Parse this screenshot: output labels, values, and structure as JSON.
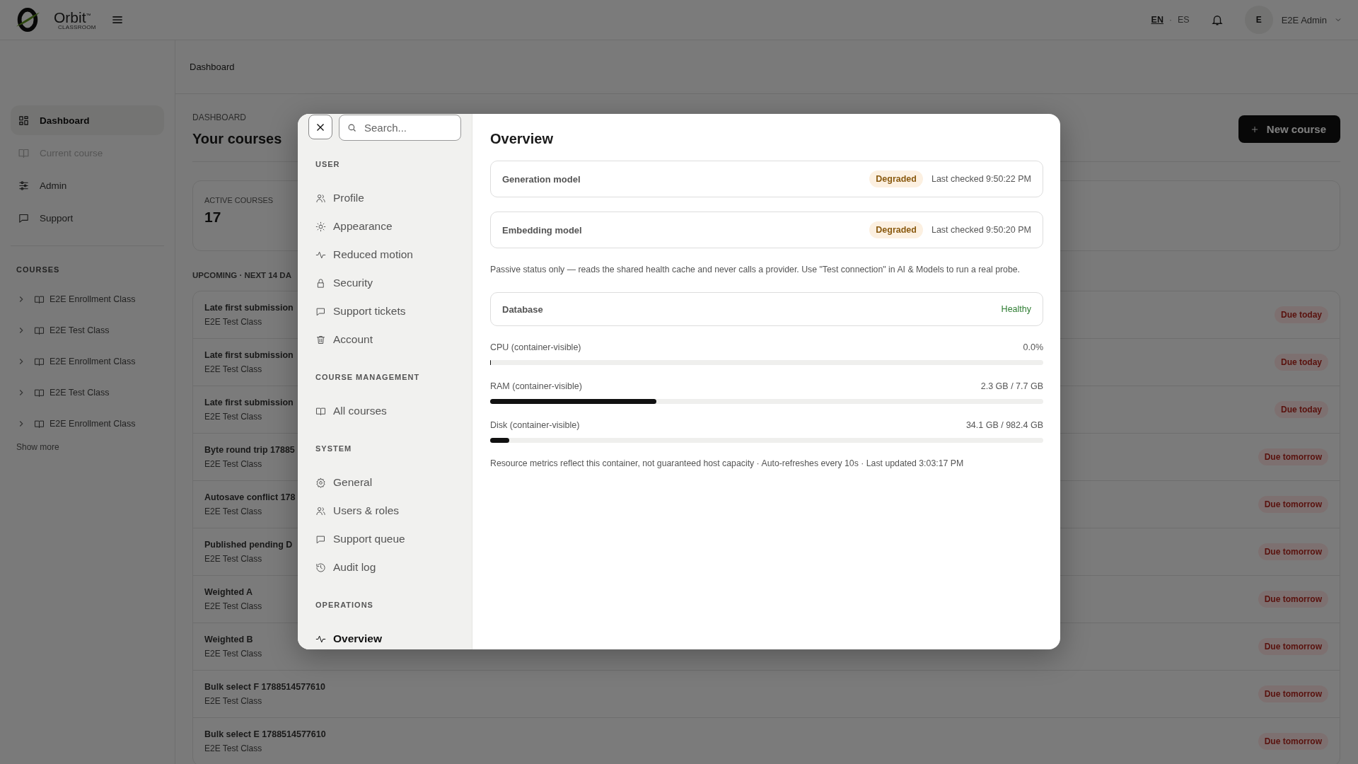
{
  "topbar": {
    "brand": "Orbit$^{™}$",
    "brand_sub": "CLASSROOM",
    "languages": [
      {
        "label": "EN",
        "selected": true
      },
      {
        "label": "ES",
        "selected": false
      }
    ],
    "language_separator": "·",
    "avatar": "E",
    "user": "E2E Admin"
  },
  "sidebar": {
    "nav": [
      {
        "label": "Dashboard",
        "selected": true,
        "disabled": false
      },
      {
        "label": "Current course",
        "selected": false,
        "disabled": true
      },
      {
        "label": "Admin",
        "selected": false,
        "disabled": false
      },
      {
        "label": "Support",
        "selected": false,
        "disabled": false
      }
    ],
    "courses_heading": "COURSES",
    "courses": [
      {
        "label": "E2E Enrollment Class",
        "expanded": false
      },
      {
        "label": "E2E Test Class",
        "expanded": false
      },
      {
        "label": "E2E Enrollment Class",
        "expanded": false
      },
      {
        "label": "E2E Test Class",
        "expanded": false
      },
      {
        "label": "E2E Enrollment Class",
        "expanded": false
      }
    ],
    "show_more": "Show more"
  },
  "main": {
    "breadcrumb": "Dashboard",
    "eyebrow": "DASHBOARD",
    "title": "Your courses",
    "new_course_button": "New course",
    "stats": [
      {
        "label": "ACTIVE COURSES",
        "value": "17"
      }
    ],
    "upcoming_heading": "UPCOMING · NEXT 14 DA",
    "assignments": [
      {
        "title": "Late first submission",
        "course": "E2E Test Class",
        "due": "Due today"
      },
      {
        "title": "Late first submission",
        "course": "E2E Test Class",
        "due": "Due today"
      },
      {
        "title": "Late first submission",
        "course": "E2E Test Class",
        "due": "Due today"
      },
      {
        "title": "Byte round trip 17885",
        "course": "E2E Test Class",
        "due": "Due tomorrow"
      },
      {
        "title": "Autosave conflict 178",
        "course": "E2E Test Class",
        "due": "Due tomorrow"
      },
      {
        "title": "Published pending D",
        "course": "E2E Test Class",
        "due": "Due tomorrow"
      },
      {
        "title": "Weighted A",
        "course": "E2E Test Class",
        "due": "Due tomorrow"
      },
      {
        "title": "Weighted B",
        "course": "E2E Test Class",
        "due": "Due tomorrow"
      },
      {
        "title": "Bulk select F 1788514577610",
        "course": "E2E Test Class",
        "due": "Due tomorrow"
      },
      {
        "title": "Bulk select E 1788514577610",
        "course": "E2E Test Class",
        "due": "Due tomorrow"
      }
    ]
  },
  "modal": {
    "search": {
      "placeholder": "Search..."
    },
    "sections": [
      {
        "title": "USER",
        "items": [
          {
            "label": "Profile",
            "selected": false
          },
          {
            "label": "Appearance",
            "selected": false
          },
          {
            "label": "Reduced motion",
            "selected": false
          },
          {
            "label": "Security",
            "selected": false
          },
          {
            "label": "Support tickets",
            "selected": false
          },
          {
            "label": "Account",
            "selected": false
          }
        ]
      },
      {
        "title": "COURSE MANAGEMENT",
        "items": [
          {
            "label": "All courses",
            "selected": false
          }
        ]
      },
      {
        "title": "SYSTEM",
        "items": [
          {
            "label": "General",
            "selected": false
          },
          {
            "label": "Users & roles",
            "selected": false
          },
          {
            "label": "Support queue",
            "selected": false
          },
          {
            "label": "Audit log",
            "selected": false
          }
        ]
      },
      {
        "title": "OPERATIONS",
        "items": [
          {
            "label": "Overview",
            "selected": true
          }
        ]
      }
    ],
    "title": "Overview",
    "model_services": [
      {
        "name": "Generation model",
        "status": "Degraded",
        "kind": "degraded",
        "checked": "Last checked 9:50:22 PM"
      },
      {
        "name": "Embedding model",
        "status": "Degraded",
        "kind": "degraded",
        "checked": "Last checked 9:50:20 PM"
      }
    ],
    "note": "Passive status only — reads the shared health cache and never calls a provider. Use \"Test connection\" in AI & Models to run a real probe.",
    "database": {
      "name": "Database",
      "status": "Healthy",
      "kind": "healthy"
    },
    "metrics": [
      {
        "label": "CPU (container-visible)",
        "reading": "0.0%",
        "level": 0.0
      },
      {
        "label": "RAM (container-visible)",
        "reading": "2.3 GB / 7.7 GB",
        "level": 0.3
      },
      {
        "label": "Disk (container-visible)",
        "reading": "34.1 GB / 982.4 GB",
        "level": 0.035
      }
    ],
    "footer": "Resource metrics reflect this container, not guaranteed host capacity · Auto-refreshes every 10s · Last updated 3:03:17 PM"
  }
}
